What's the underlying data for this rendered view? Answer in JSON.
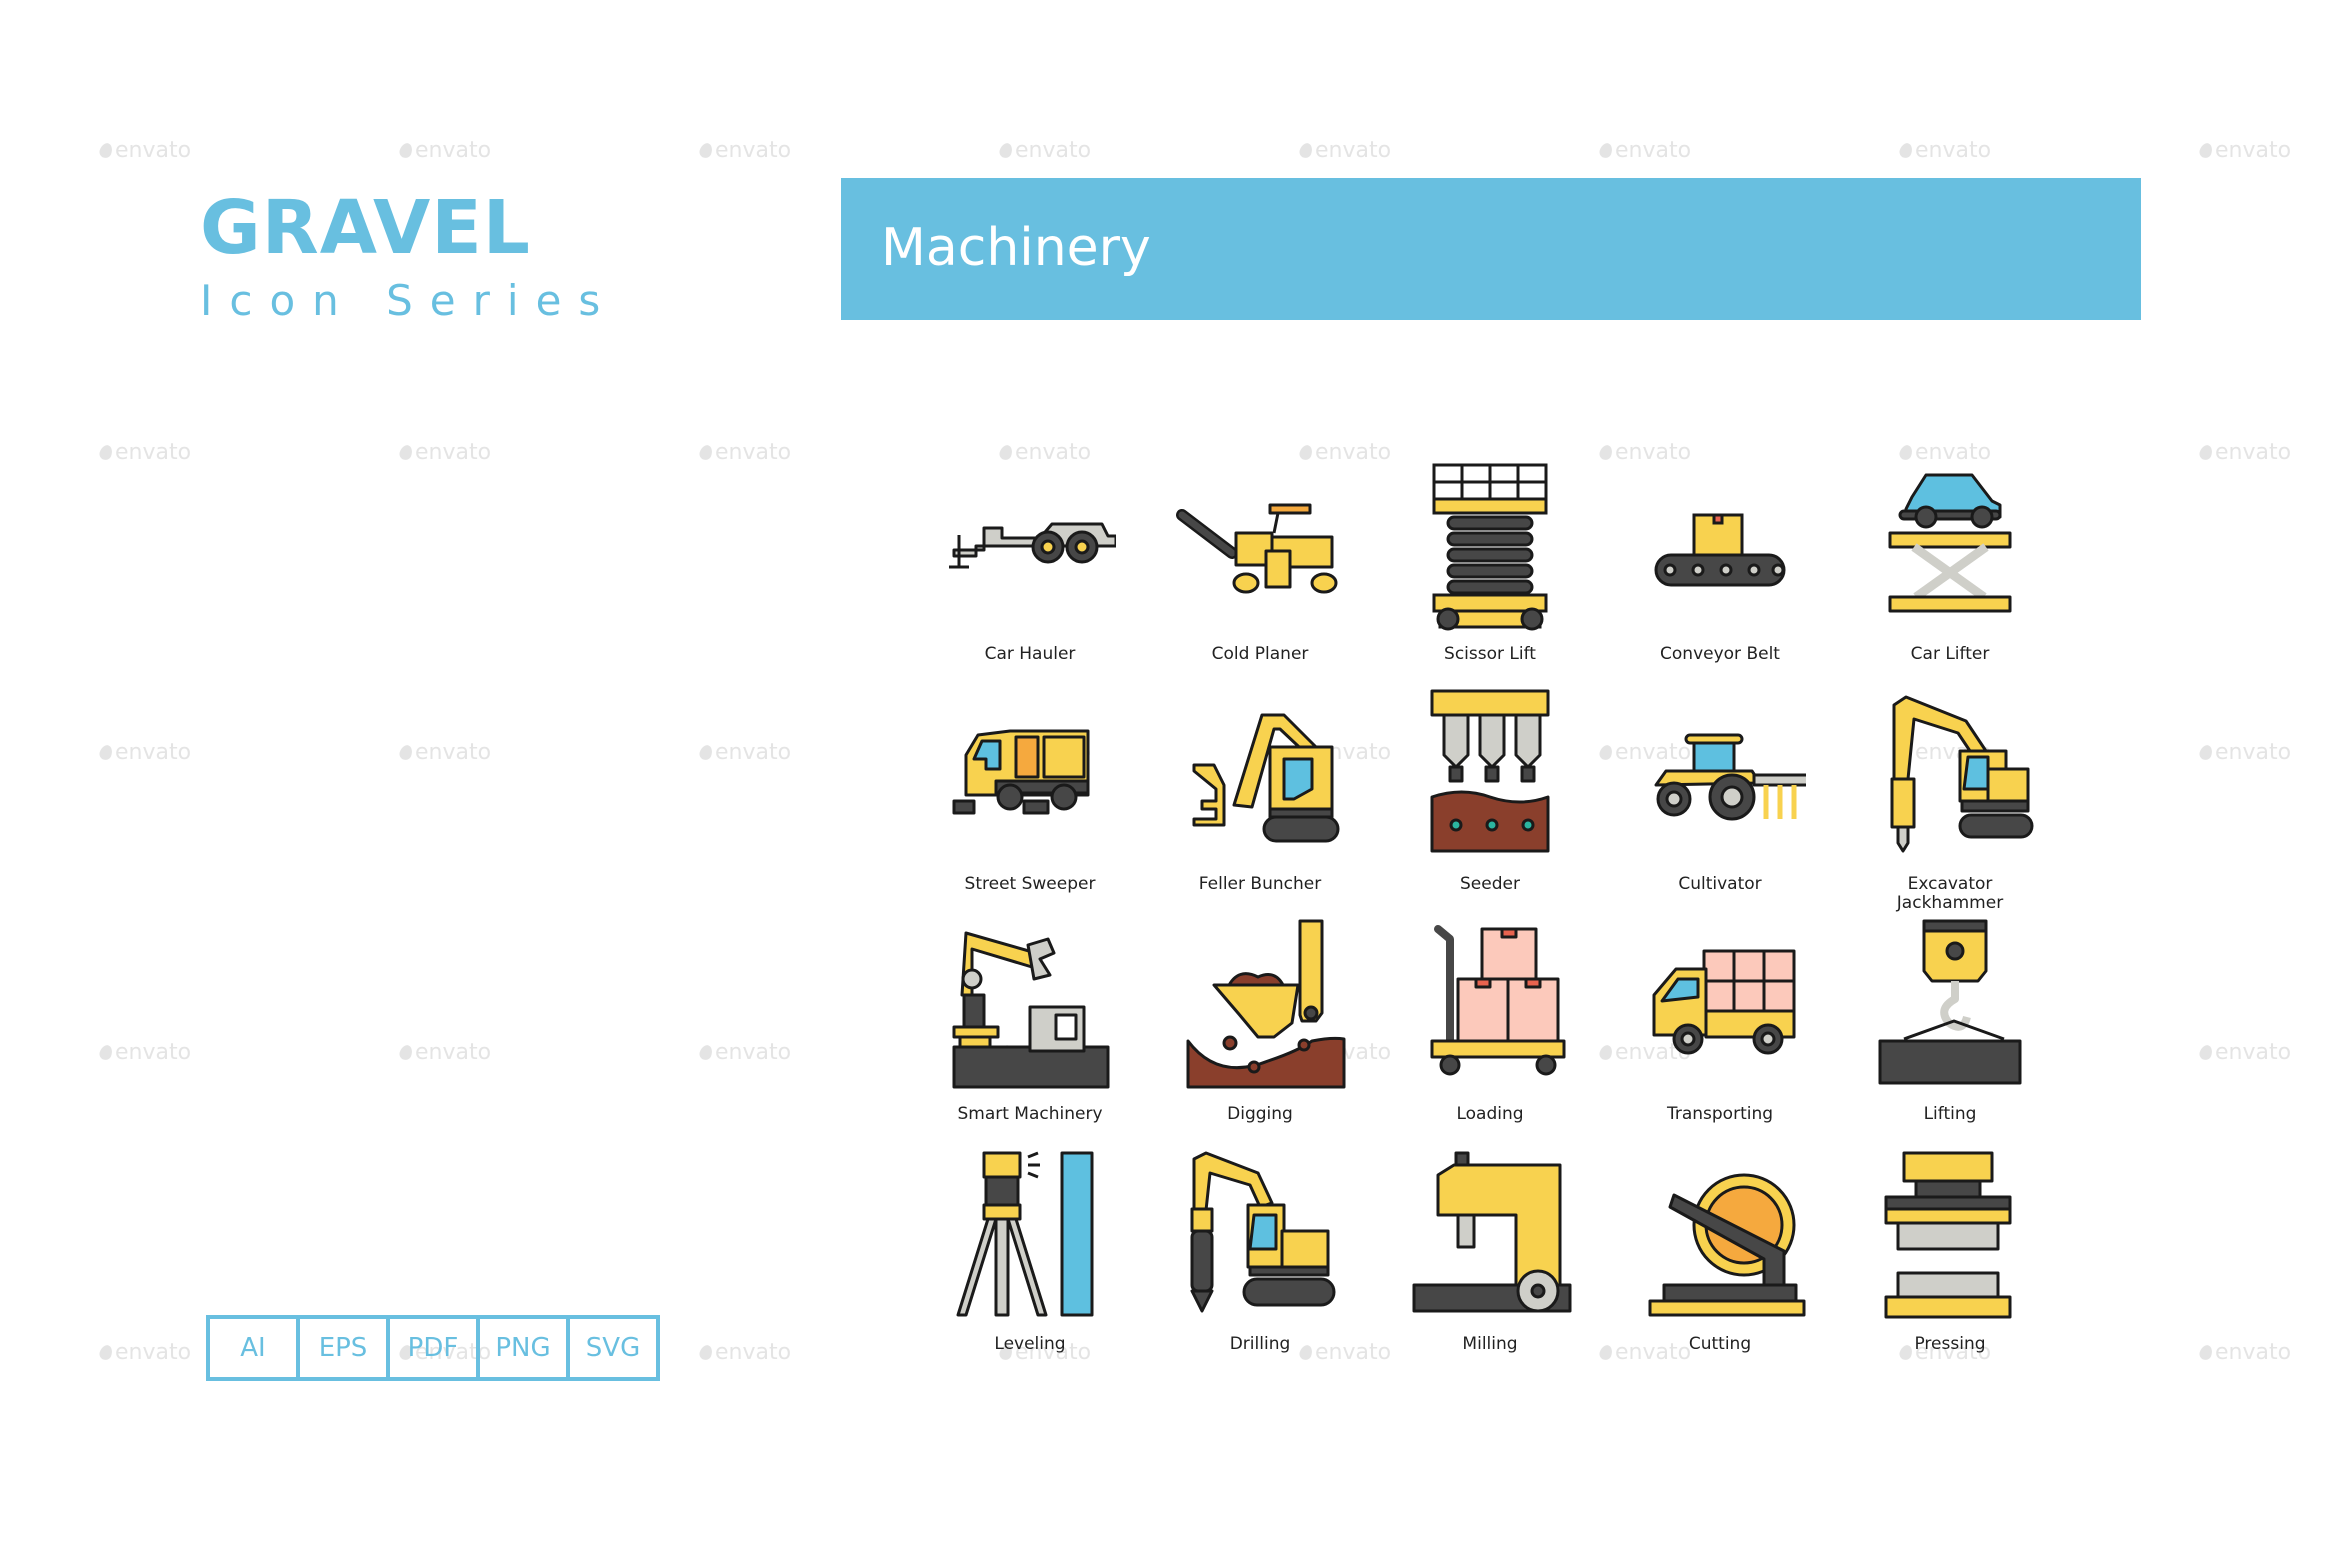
{
  "brand": {
    "title": "GRAVEL",
    "subtitle": "Icon Series"
  },
  "banner": {
    "title": "Machinery"
  },
  "formats": [
    "AI",
    "EPS",
    "PDF",
    "PNG",
    "SVG"
  ],
  "watermark": {
    "text": "envato",
    "icon": "envato-drop-icon"
  },
  "colors": {
    "accent": "#68bfe0",
    "yellow": "#f8d24f",
    "orange": "#f5a93e",
    "dark": "#474747",
    "outline": "#1a1a1a",
    "gray": "#cfcfc9",
    "blue": "#5ec0e0",
    "brown": "#8a3f2c",
    "pink": "#fcc9bb"
  },
  "icons": [
    {
      "label": "Car Hauler",
      "icon": "car-hauler-icon"
    },
    {
      "label": "Cold Planer",
      "icon": "cold-planer-icon"
    },
    {
      "label": "Scissor Lift",
      "icon": "scissor-lift-icon"
    },
    {
      "label": "Conveyor Belt",
      "icon": "conveyor-belt-icon"
    },
    {
      "label": "Car Lifter",
      "icon": "car-lifter-icon"
    },
    {
      "label": "Street Sweeper",
      "icon": "street-sweeper-icon"
    },
    {
      "label": "Feller Buncher",
      "icon": "feller-buncher-icon"
    },
    {
      "label": "Seeder",
      "icon": "seeder-icon"
    },
    {
      "label": "Cultivator",
      "icon": "cultivator-icon"
    },
    {
      "label": "Excavator Jackhammer",
      "icon": "excavator-jackhammer-icon"
    },
    {
      "label": "Smart Machinery",
      "icon": "smart-machinery-icon"
    },
    {
      "label": "Digging",
      "icon": "digging-icon"
    },
    {
      "label": "Loading",
      "icon": "loading-icon"
    },
    {
      "label": "Transporting",
      "icon": "transporting-icon"
    },
    {
      "label": "Lifting",
      "icon": "lifting-icon"
    },
    {
      "label": "Leveling",
      "icon": "leveling-icon"
    },
    {
      "label": "Drilling",
      "icon": "drilling-icon"
    },
    {
      "label": "Milling",
      "icon": "milling-icon"
    },
    {
      "label": "Cutting",
      "icon": "cutting-icon"
    },
    {
      "label": "Pressing",
      "icon": "pressing-icon"
    }
  ]
}
